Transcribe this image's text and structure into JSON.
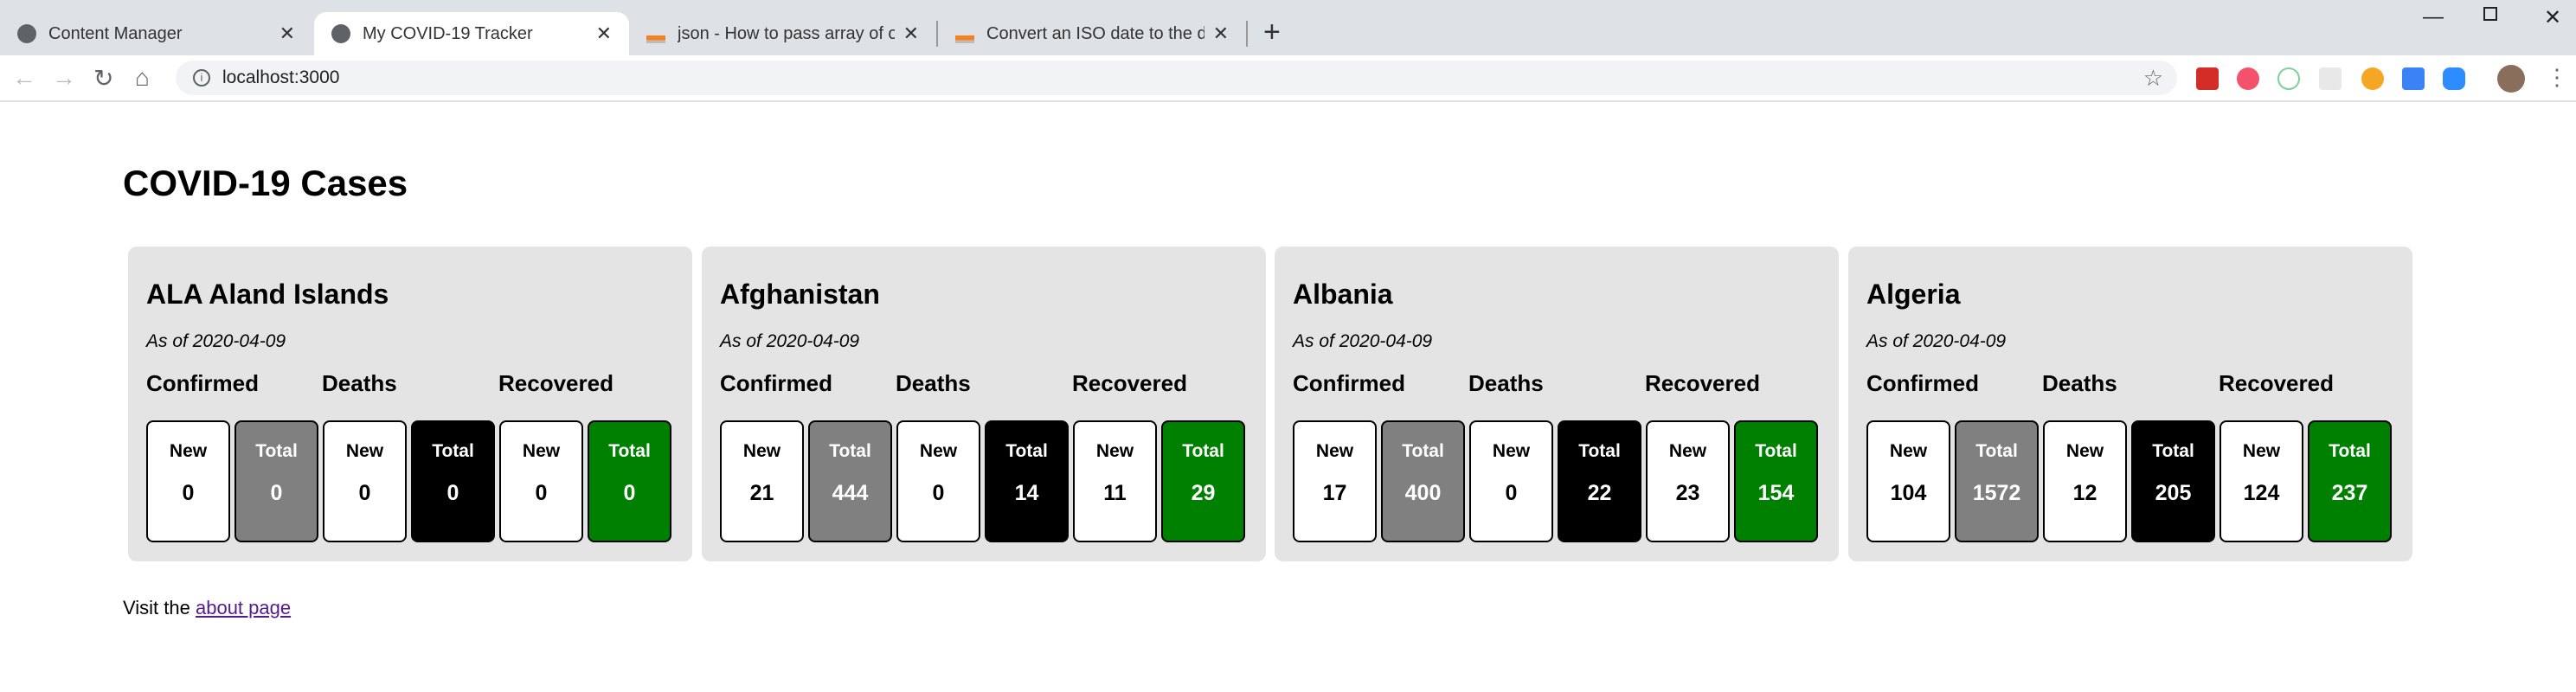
{
  "browser": {
    "tabs": [
      {
        "title": "Content Manager",
        "icon": "globe-icon"
      },
      {
        "title": "My COVID-19 Tracker",
        "icon": "globe-icon",
        "active": true
      },
      {
        "title": "json - How to pass array of objec",
        "icon": "stackoverflow-icon"
      },
      {
        "title": "Convert an ISO date to the date f",
        "icon": "stackoverflow-icon"
      }
    ],
    "url": "localhost:3000",
    "extensions": [
      "lastpass-icon",
      "todoist-icon",
      "search-ext-icon",
      "react-icon",
      "web-archive-icon",
      "tag-icon",
      "zoom-icon"
    ]
  },
  "page": {
    "title": "COVID-19 Cases",
    "sections": {
      "confirmed": "Confirmed",
      "deaths": "Deaths",
      "recovered": "Recovered"
    },
    "labels": {
      "new": "New",
      "total": "Total"
    },
    "colors": {
      "confirmed_total": "#808080",
      "deaths_total": "#000000",
      "recovered_total": "#008000"
    },
    "countries": [
      {
        "name": "ALA Aland Islands",
        "date": "As of 2020-04-09",
        "confirmed_new": "0",
        "confirmed_total": "0",
        "deaths_new": "0",
        "deaths_total": "0",
        "recovered_new": "0",
        "recovered_total": "0"
      },
      {
        "name": "Afghanistan",
        "date": "As of 2020-04-09",
        "confirmed_new": "21",
        "confirmed_total": "444",
        "deaths_new": "0",
        "deaths_total": "14",
        "recovered_new": "11",
        "recovered_total": "29"
      },
      {
        "name": "Albania",
        "date": "As of 2020-04-09",
        "confirmed_new": "17",
        "confirmed_total": "400",
        "deaths_new": "0",
        "deaths_total": "22",
        "recovered_new": "23",
        "recovered_total": "154"
      },
      {
        "name": "Algeria",
        "date": "As of 2020-04-09",
        "confirmed_new": "104",
        "confirmed_total": "1572",
        "deaths_new": "12",
        "deaths_total": "205",
        "recovered_new": "124",
        "recovered_total": "237"
      }
    ],
    "footer": {
      "prefix": "Visit the ",
      "link": "about page"
    }
  }
}
